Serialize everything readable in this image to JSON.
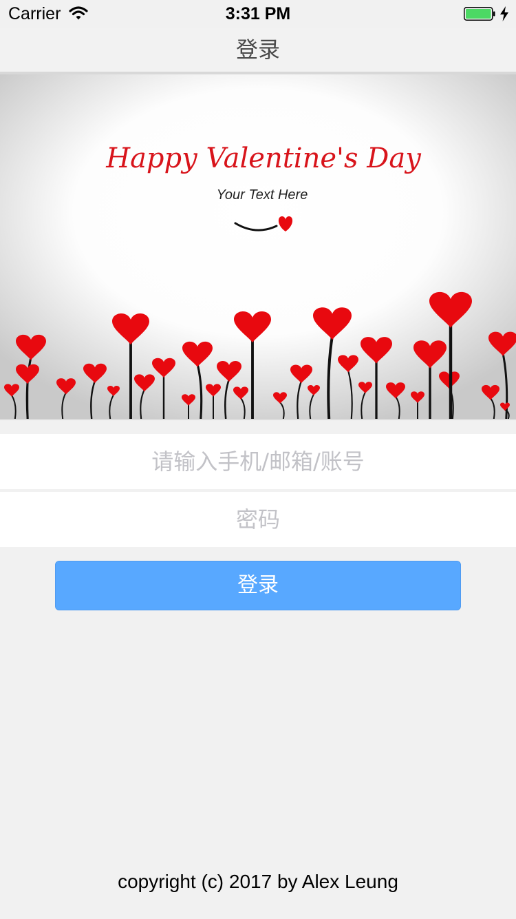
{
  "status_bar": {
    "carrier": "Carrier",
    "time": "3:31 PM",
    "battery_color": "#4cd964"
  },
  "nav": {
    "title": "登录"
  },
  "banner": {
    "headline": "Happy Valentine's Day",
    "subtitle": "Your Text Here",
    "heart_color": "#e8090f"
  },
  "form": {
    "account_placeholder": "请输入手机/邮箱/账号",
    "password_placeholder": "密码",
    "login_label": "登录"
  },
  "footer": {
    "copyright": "copyright (c) 2017 by Alex Leung"
  },
  "colors": {
    "accent": "#58a8ff",
    "background": "#f1f1f1"
  }
}
